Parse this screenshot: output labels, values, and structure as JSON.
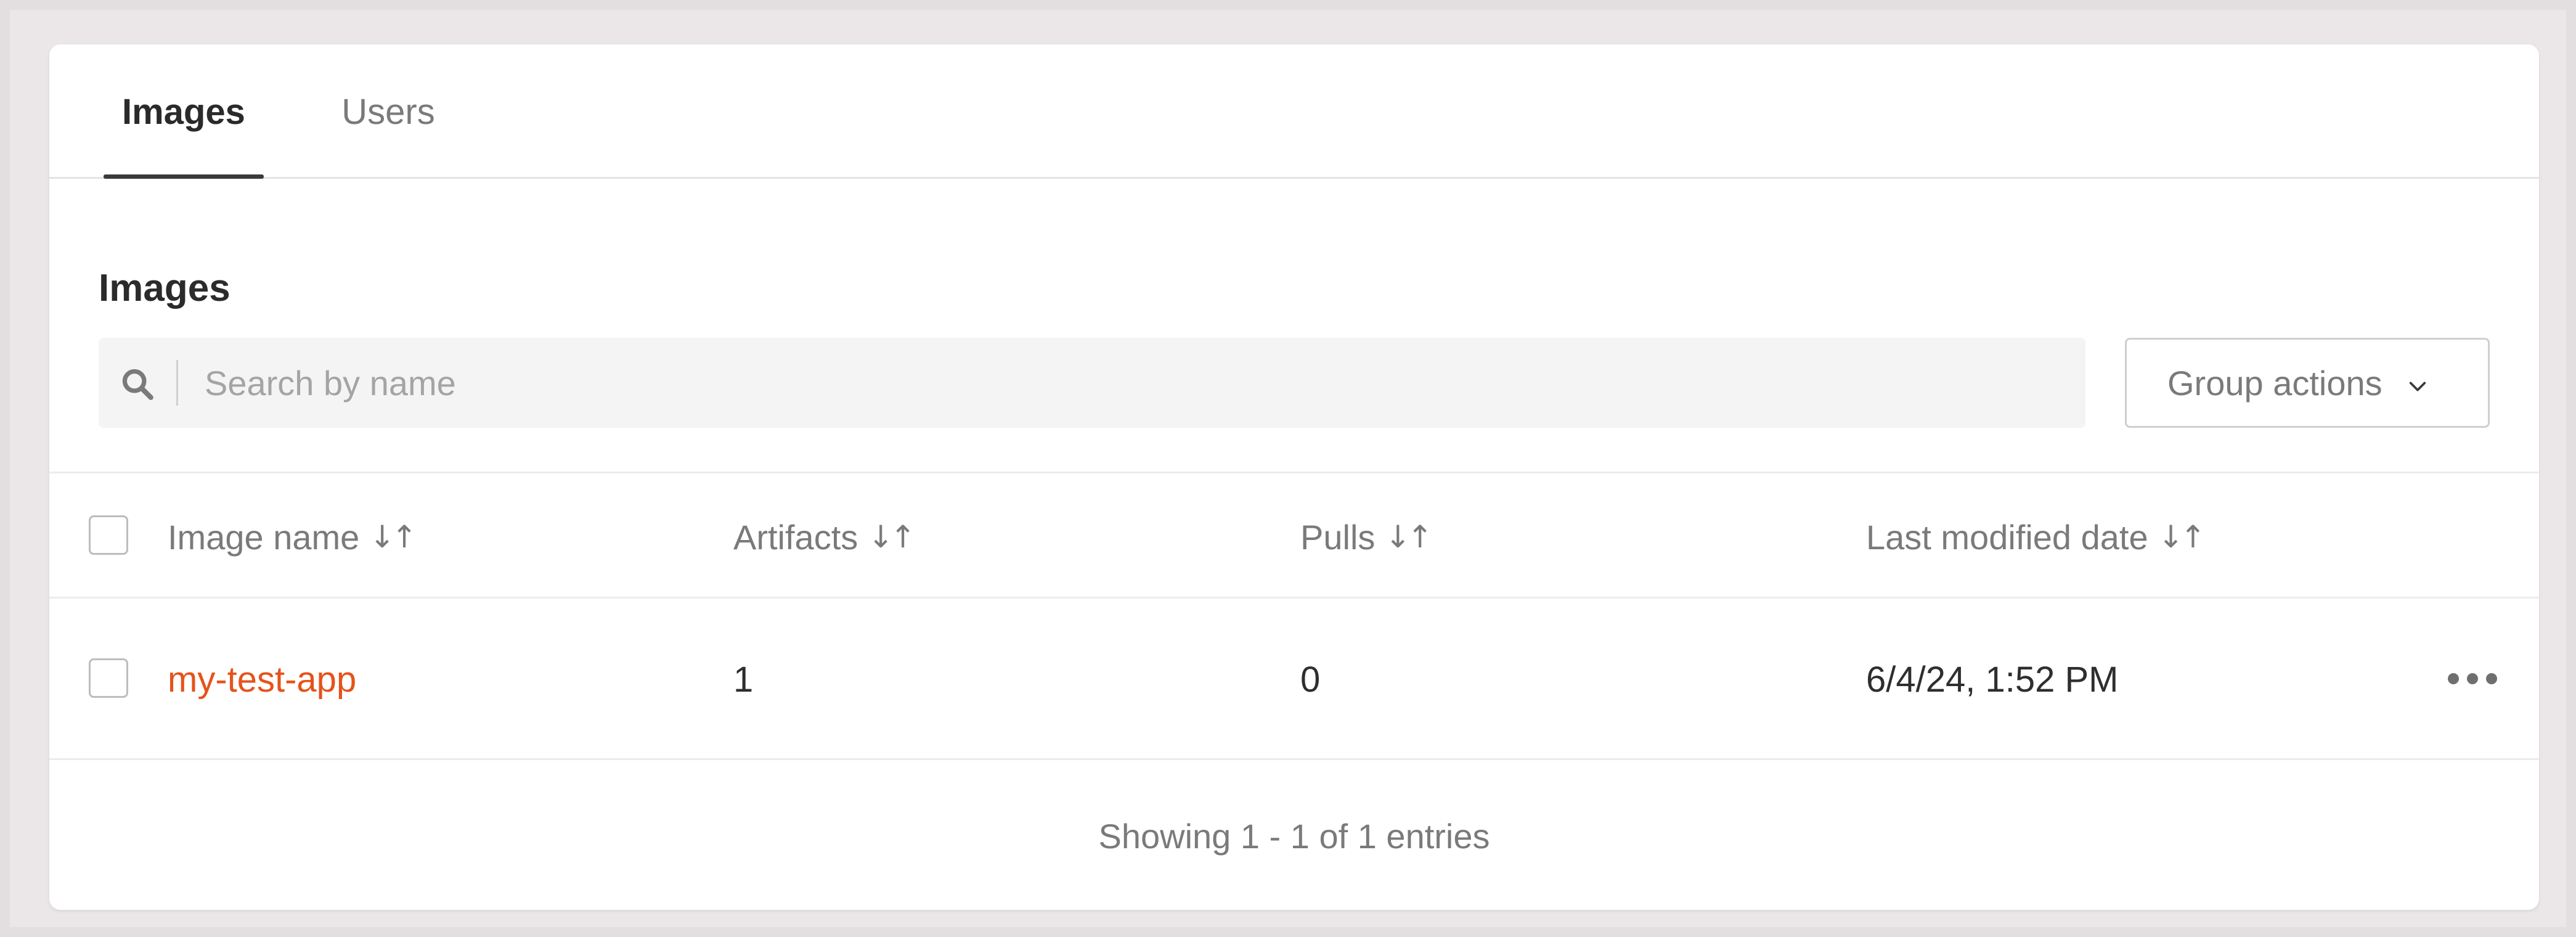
{
  "tabs": [
    {
      "label": "Images",
      "active": true
    },
    {
      "label": "Users",
      "active": false
    }
  ],
  "section": {
    "title": "Images"
  },
  "search": {
    "placeholder": "Search by name",
    "value": "",
    "icon": "search-icon"
  },
  "group_actions": {
    "label": "Group actions",
    "icon": "chevron-down-icon"
  },
  "table": {
    "columns": [
      {
        "label": "Image name",
        "sort_icon": "↓↑"
      },
      {
        "label": "Artifacts",
        "sort_icon": "↓↑"
      },
      {
        "label": "Pulls",
        "sort_icon": "↓↑"
      },
      {
        "label": "Last modified date",
        "sort_icon": "↓↑"
      }
    ],
    "rows": [
      {
        "name": "my-test-app",
        "artifacts": "1",
        "pulls": "0",
        "last_modified": "6/4/24, 1:52 PM",
        "menu_icon": "more-horizontal-icon"
      }
    ]
  },
  "footer": {
    "text": "Showing 1 - 1 of 1 entries"
  },
  "colors": {
    "accent_link": "#e5531a",
    "text_primary": "#2e2e2e",
    "text_muted": "#7a7a7a",
    "background": "#ebe7e8"
  }
}
